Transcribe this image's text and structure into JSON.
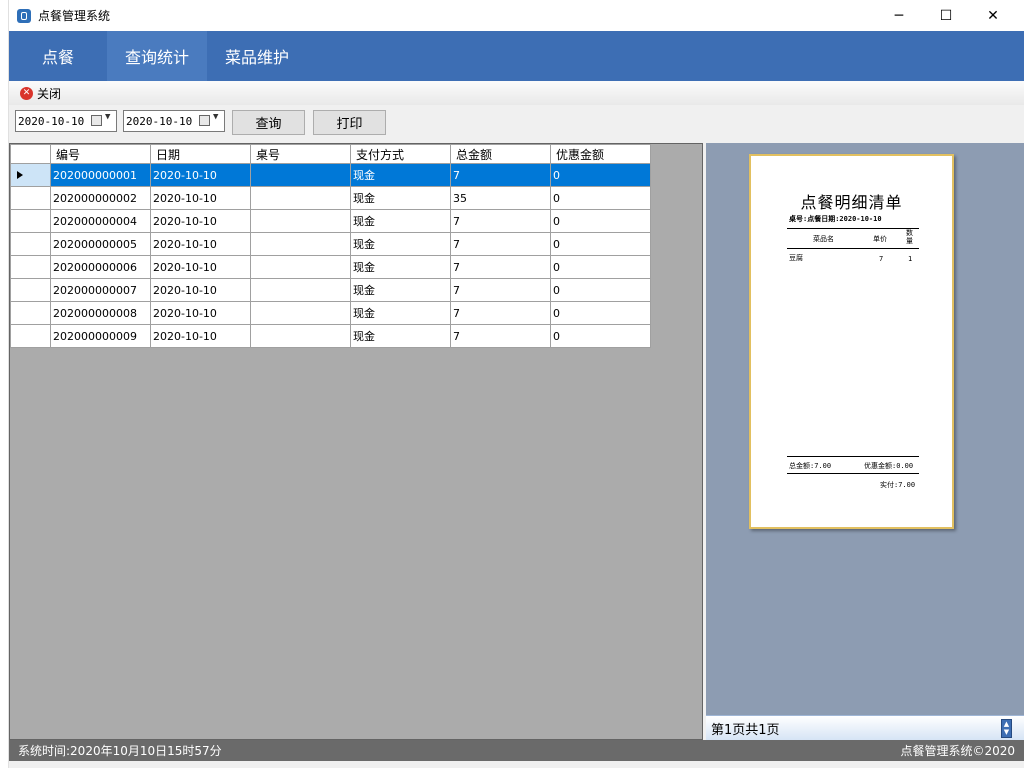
{
  "window": {
    "title": "点餐管理系统",
    "controls": {
      "minimize": "─",
      "maximize": "☐",
      "close": "✕"
    }
  },
  "menu": {
    "items": [
      {
        "label": "点餐"
      },
      {
        "label": "查询统计"
      },
      {
        "label": "菜品维护"
      }
    ]
  },
  "toolbar": {
    "close_label": "关闭"
  },
  "filter": {
    "start_date": "2020-10-10",
    "end_date": "2020-10-10",
    "query_label": "查询",
    "print_label": "打印"
  },
  "grid": {
    "columns": [
      "编号",
      "日期",
      "桌号",
      "支付方式",
      "总金额",
      "优惠金额"
    ],
    "selected_row": 0,
    "rows": [
      [
        "202000000001",
        "2020-10-10",
        "",
        "现金",
        "7",
        "0"
      ],
      [
        "202000000002",
        "2020-10-10",
        "",
        "现金",
        "35",
        "0"
      ],
      [
        "202000000004",
        "2020-10-10",
        "",
        "现金",
        "7",
        "0"
      ],
      [
        "202000000005",
        "2020-10-10",
        "",
        "现金",
        "7",
        "0"
      ],
      [
        "202000000006",
        "2020-10-10",
        "",
        "现金",
        "7",
        "0"
      ],
      [
        "202000000007",
        "2020-10-10",
        "",
        "现金",
        "7",
        "0"
      ],
      [
        "202000000008",
        "2020-10-10",
        "",
        "现金",
        "7",
        "0"
      ],
      [
        "202000000009",
        "2020-10-10",
        "",
        "现金",
        "7",
        "0"
      ]
    ]
  },
  "preview": {
    "title": "点餐明细清单",
    "subtitle": "桌号:点餐日期:2020-10-10",
    "col_item": "菜品名",
    "col_price": "单价",
    "col_qty": "数量",
    "item_name": "豆腐",
    "item_price": "7",
    "item_qty": "1",
    "total": "总金额:7.00",
    "discount": "优惠金额:0.00",
    "paid": "实付:7.00",
    "page_label": "第1页共1页"
  },
  "status": {
    "time": "系统时间:2020年10月10日15时57分",
    "copyright": "点餐管理系统©2020"
  }
}
